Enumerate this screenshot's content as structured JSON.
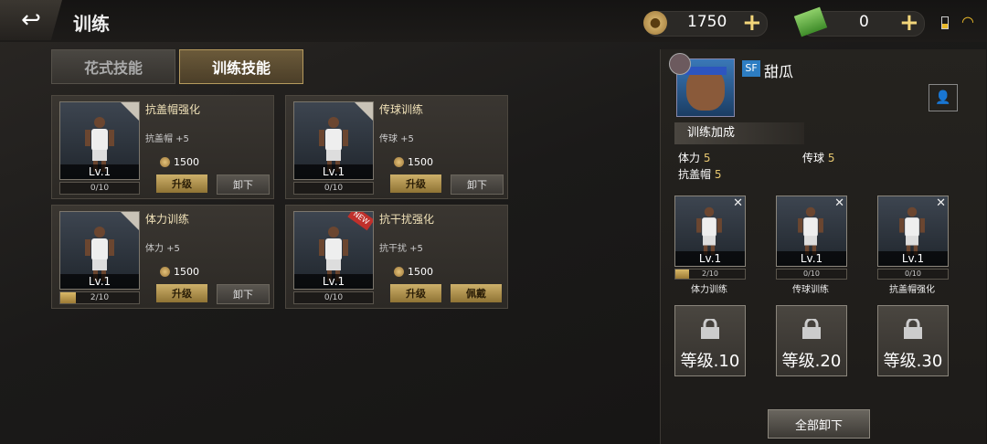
{
  "header": {
    "back_icon": "back-arrow-icon",
    "title": "训练",
    "coins": "1750",
    "cash": "0",
    "plus": "+"
  },
  "tabs": [
    {
      "label": "花式技能",
      "active": false
    },
    {
      "label": "训练技能",
      "active": true
    }
  ],
  "cards": [
    {
      "name": "抗盖帽强化",
      "attr": "抗盖帽 +5",
      "level": "Lv.1",
      "progress": "0/10",
      "progress_value": 0,
      "cost": "1500",
      "btn1": "升级",
      "btn2": "卸下",
      "equipped": true,
      "new": false
    },
    {
      "name": "传球训练",
      "attr": "传球 +5",
      "level": "Lv.1",
      "progress": "0/10",
      "progress_value": 0,
      "cost": "1500",
      "btn1": "升级",
      "btn2": "卸下",
      "equipped": true,
      "new": false
    },
    {
      "name": "体力训练",
      "attr": "体力 +5",
      "level": "Lv.1",
      "progress": "2/10",
      "progress_value": 0.2,
      "cost": "1500",
      "btn1": "升级",
      "btn2": "卸下",
      "equipped": true,
      "new": false
    },
    {
      "name": "抗干扰强化",
      "attr": "抗干扰 +5",
      "level": "Lv.1",
      "progress": "0/10",
      "progress_value": 0,
      "cost": "1500",
      "btn1": "升级",
      "btn2": "佩戴",
      "equipped": false,
      "new": true,
      "new_label": "NEW"
    }
  ],
  "player": {
    "position": "SF",
    "name": "甜瓜"
  },
  "bonus": {
    "title": "训练加成",
    "stats": [
      {
        "label": "体力",
        "value": "5"
      },
      {
        "label": "传球",
        "value": "5"
      },
      {
        "label": "抗盖帽",
        "value": "5"
      }
    ]
  },
  "slots": [
    {
      "name": "体力训练",
      "level": "Lv.1",
      "progress": "2/10",
      "progress_value": 0.2
    },
    {
      "name": "传球训练",
      "level": "Lv.1",
      "progress": "0/10",
      "progress_value": 0
    },
    {
      "name": "抗盖帽强化",
      "level": "Lv.1",
      "progress": "0/10",
      "progress_value": 0
    }
  ],
  "locked": [
    {
      "label": "等级.10"
    },
    {
      "label": "等级.20"
    },
    {
      "label": "等级.30"
    }
  ],
  "remove_all": "全部卸下",
  "colors": {
    "gold": "#d9b968",
    "accent_blue": "#2d7dc2"
  }
}
